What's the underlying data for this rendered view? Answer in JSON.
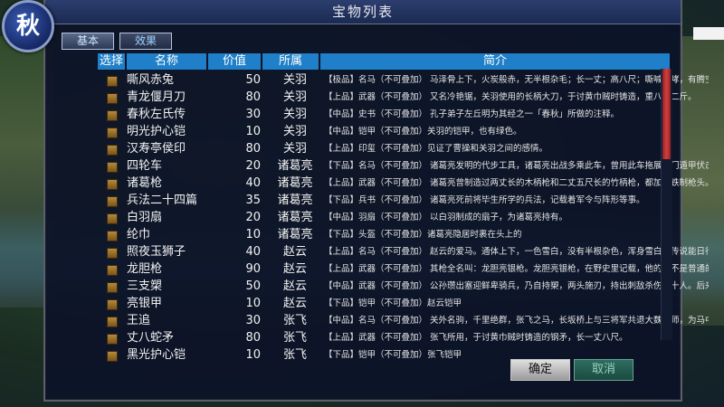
{
  "window": {
    "title": "宝物列表",
    "seal_char": "秋"
  },
  "tabs": [
    {
      "label": "基本",
      "active": true
    },
    {
      "label": "效果",
      "active": false
    }
  ],
  "table": {
    "headers": [
      "选择",
      "名称",
      "价值",
      "所属",
      "简介"
    ],
    "rows": [
      {
        "name": "嘶风赤兔",
        "value": "50",
        "owner": "关羽",
        "desc": "【极品】名马（不可叠加） 马泽骨上下，火炭般赤，无半根杂毛；长一丈；高八尺；嘶喊咆哮，有腾空入海之状 此马能日行千里"
      },
      {
        "name": "青龙偃月刀",
        "value": "80",
        "owner": "关羽",
        "desc": "【上品】武器（不可叠加） 又名冷艳锯，关羽使用的长柄大刀，于讨黄巾贼时铸造，重八十二斤。"
      },
      {
        "name": "春秋左氏传",
        "value": "30",
        "owner": "关羽",
        "desc": "【中品】史书（不可叠加） 孔子弟子左丘明为其经之一「春秋」所做的注释。"
      },
      {
        "name": "明光护心铠",
        "value": "10",
        "owner": "关羽",
        "desc": "【中品】铠甲（不可叠加）关羽的铠甲，也有绿色。"
      },
      {
        "name": "汉寿亭侯印",
        "value": "80",
        "owner": "关羽",
        "desc": "【上品】印玺（不可叠加）见证了曹操和关羽之间的感情。"
      },
      {
        "name": "四轮车",
        "value": "20",
        "owner": "诸葛亮",
        "desc": "【下品】名马（不可叠加） 诸葛亮发明的代步工具，诸葛亮出战多乘此车，曾用此车拖展奇门遁甲伏击司马懿，并在死后在车上安"
      },
      {
        "name": "诸葛枪",
        "value": "40",
        "owner": "诸葛亮",
        "desc": "【上品】武器（不可叠加） 诸葛亮曾制造过两丈长的木柄枪和二丈五尺长的竹柄枪，都加上铁制枪头。出于《事物纪原》。这支枪"
      },
      {
        "name": "兵法二十四篇",
        "value": "35",
        "owner": "诸葛亮",
        "desc": "【下品】兵书（不可叠加） 诸葛亮死前将毕生所学的兵法，记载着军令与阵形等事。"
      },
      {
        "name": "白羽扇",
        "value": "20",
        "owner": "诸葛亮",
        "desc": "【中品】羽扇（不可叠加） 以白羽制成的扇子，为诸葛亮持有。"
      },
      {
        "name": "纶巾",
        "value": "10",
        "owner": "诸葛亮",
        "desc": "【下品】头盔（不可叠加）诸葛亮隐居时裹在头上的"
      },
      {
        "name": "照夜玉狮子",
        "value": "40",
        "owner": "赵云",
        "desc": "【上品】名马（不可叠加） 赵云的爱马。通体上下，一色雪白，没有半根杂色，浑身雪白，传说能日行千里，因夜里身发银白光"
      },
      {
        "name": "龙胆枪",
        "value": "90",
        "owner": "赵云",
        "desc": "【上品】武器（不可叠加） 其枪全名叫：龙胆亮银枪。龙胆亮银枪，在野史里记载，他的枪不是普通的，是家传的，他的母亲"
      },
      {
        "name": "三支槊",
        "value": "50",
        "owner": "赵云",
        "desc": "【中品】武器（不可叠加） 公孙瓒出塞迎鲜卑骑兵，乃自持槊，两头施刃，持出刺敌杀伤数十人。后来在战中死用此槊迎战敌军"
      },
      {
        "name": "亮银甲",
        "value": "10",
        "owner": "赵云",
        "desc": "【下品】铠甲（不可叠加）赵云铠甲"
      },
      {
        "name": "王追",
        "value": "30",
        "owner": "张飞",
        "desc": "【中品】名马（不可叠加） 关外名驹，千里绝群，张飞之马，长坂桥上与三将军共退大魏雄师，为马中英雄。"
      },
      {
        "name": "丈八蛇矛",
        "value": "80",
        "owner": "张飞",
        "desc": "【上品】武器（不可叠加） 张飞所用，于讨黄巾贼时铸造的钢矛，长一丈八尺。"
      },
      {
        "name": "黑光护心铠",
        "value": "10",
        "owner": "张飞",
        "desc": "【下品】铠甲（不可叠加）张飞铠甲"
      }
    ]
  },
  "buttons": {
    "ok": "确定",
    "cancel": "取消"
  }
}
